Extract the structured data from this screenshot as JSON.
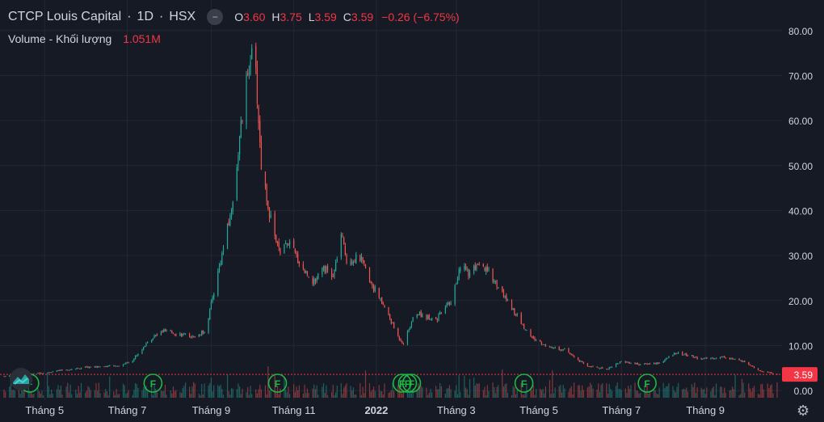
{
  "header": {
    "symbol": "CTCP Louis Capital",
    "interval": "1D",
    "exchange": "HSX",
    "open_label": "O",
    "open": "3.60",
    "high_label": "H",
    "high": "3.75",
    "low_label": "L",
    "low": "3.59",
    "close_label": "C",
    "close": "3.59",
    "change": "−0.26 (−6.75%)",
    "close_button_glyph": "−"
  },
  "volume_legend": {
    "label": "Volume - Khối lượng",
    "value": "1.051M"
  },
  "settings_icon": "gear-icon",
  "colors": {
    "up": "#26a69a",
    "down": "#ef5350",
    "background": "#161a25",
    "grid": "#232734",
    "text": "#d1d4dc",
    "price_line": "#f23645",
    "event": "#1fb842"
  },
  "chart_data": {
    "type": "candlestick",
    "y_ticks": [
      "80.00",
      "70.00",
      "60.00",
      "50.00",
      "40.00",
      "30.00",
      "20.00",
      "10.00",
      "0.00"
    ],
    "y_tick_values": [
      80,
      70,
      60,
      50,
      40,
      30,
      20,
      10,
      0
    ],
    "ylim": [
      -0.7,
      83.2
    ],
    "last_price": "3.59",
    "last_price_value": 3.59,
    "x_labels": [
      "Tháng 5",
      "Tháng 7",
      "Tháng 9",
      "Tháng 11",
      "2022",
      "Tháng 3",
      "Tháng 5",
      "Tháng 7",
      "Tháng 9"
    ],
    "x_label_dates": [
      "2021-05-01",
      "2021-07-01",
      "2021-09-01",
      "2021-11-01",
      "2022-01-01",
      "2022-03-01",
      "2022-05-01",
      "2022-07-01",
      "2022-09-01"
    ],
    "x_range": [
      "2021-04-01",
      "2022-10-24"
    ],
    "event_marker_label": "F",
    "event_dates": [
      "2021-04-20",
      "2021-07-20",
      "2021-10-20",
      "2022-01-20",
      "2022-01-24",
      "2022-01-27",
      "2022-04-20",
      "2022-07-20"
    ],
    "price_path": [
      [
        "2021-04-01",
        3.2
      ],
      [
        "2021-05-01",
        4.0
      ],
      [
        "2021-06-01",
        5.2
      ],
      [
        "2021-06-25",
        5.5
      ],
      [
        "2021-07-05",
        6.8
      ],
      [
        "2021-07-18",
        11.5
      ],
      [
        "2021-07-28",
        13.2
      ],
      [
        "2021-08-10",
        12.5
      ],
      [
        "2021-08-20",
        11.8
      ],
      [
        "2021-08-28",
        13.5
      ],
      [
        "2021-09-08",
        29.0
      ],
      [
        "2021-09-16",
        40.0
      ],
      [
        "2021-09-24",
        61.0
      ],
      [
        "2021-09-30",
        75.0
      ],
      [
        "2021-10-04",
        70.0
      ],
      [
        "2021-10-08",
        50.0
      ],
      [
        "2021-10-15",
        38.0
      ],
      [
        "2021-10-22",
        30.0
      ],
      [
        "2021-10-28",
        33.0
      ],
      [
        "2021-11-08",
        27.0
      ],
      [
        "2021-11-16",
        24.0
      ],
      [
        "2021-11-22",
        28.0
      ],
      [
        "2021-11-30",
        25.0
      ],
      [
        "2021-12-06",
        34.5
      ],
      [
        "2021-12-10",
        29.0
      ],
      [
        "2021-12-20",
        29.5
      ],
      [
        "2021-12-28",
        24.0
      ],
      [
        "2022-01-07",
        18.5
      ],
      [
        "2022-01-17",
        12.0
      ],
      [
        "2022-01-21",
        10.5
      ],
      [
        "2022-01-30",
        17.5
      ],
      [
        "2022-02-05",
        16.5
      ],
      [
        "2022-02-15",
        16.0
      ],
      [
        "2022-02-25",
        20.0
      ],
      [
        "2022-03-06",
        29.0
      ],
      [
        "2022-03-10",
        26.0
      ],
      [
        "2022-03-18",
        27.5
      ],
      [
        "2022-03-26",
        26.0
      ],
      [
        "2022-04-03",
        22.0
      ],
      [
        "2022-04-10",
        19.0
      ],
      [
        "2022-04-20",
        14.0
      ],
      [
        "2022-04-27",
        11.5
      ],
      [
        "2022-05-06",
        10.0
      ],
      [
        "2022-05-20",
        9.0
      ],
      [
        "2022-06-05",
        5.5
      ],
      [
        "2022-06-20",
        4.8
      ],
      [
        "2022-07-01",
        6.5
      ],
      [
        "2022-07-15",
        5.8
      ],
      [
        "2022-07-30",
        6.2
      ],
      [
        "2022-08-10",
        8.5
      ],
      [
        "2022-08-30",
        7.0
      ],
      [
        "2022-09-15",
        7.5
      ],
      [
        "2022-09-28",
        6.5
      ],
      [
        "2022-10-10",
        4.5
      ],
      [
        "2022-10-24",
        3.59
      ]
    ]
  }
}
